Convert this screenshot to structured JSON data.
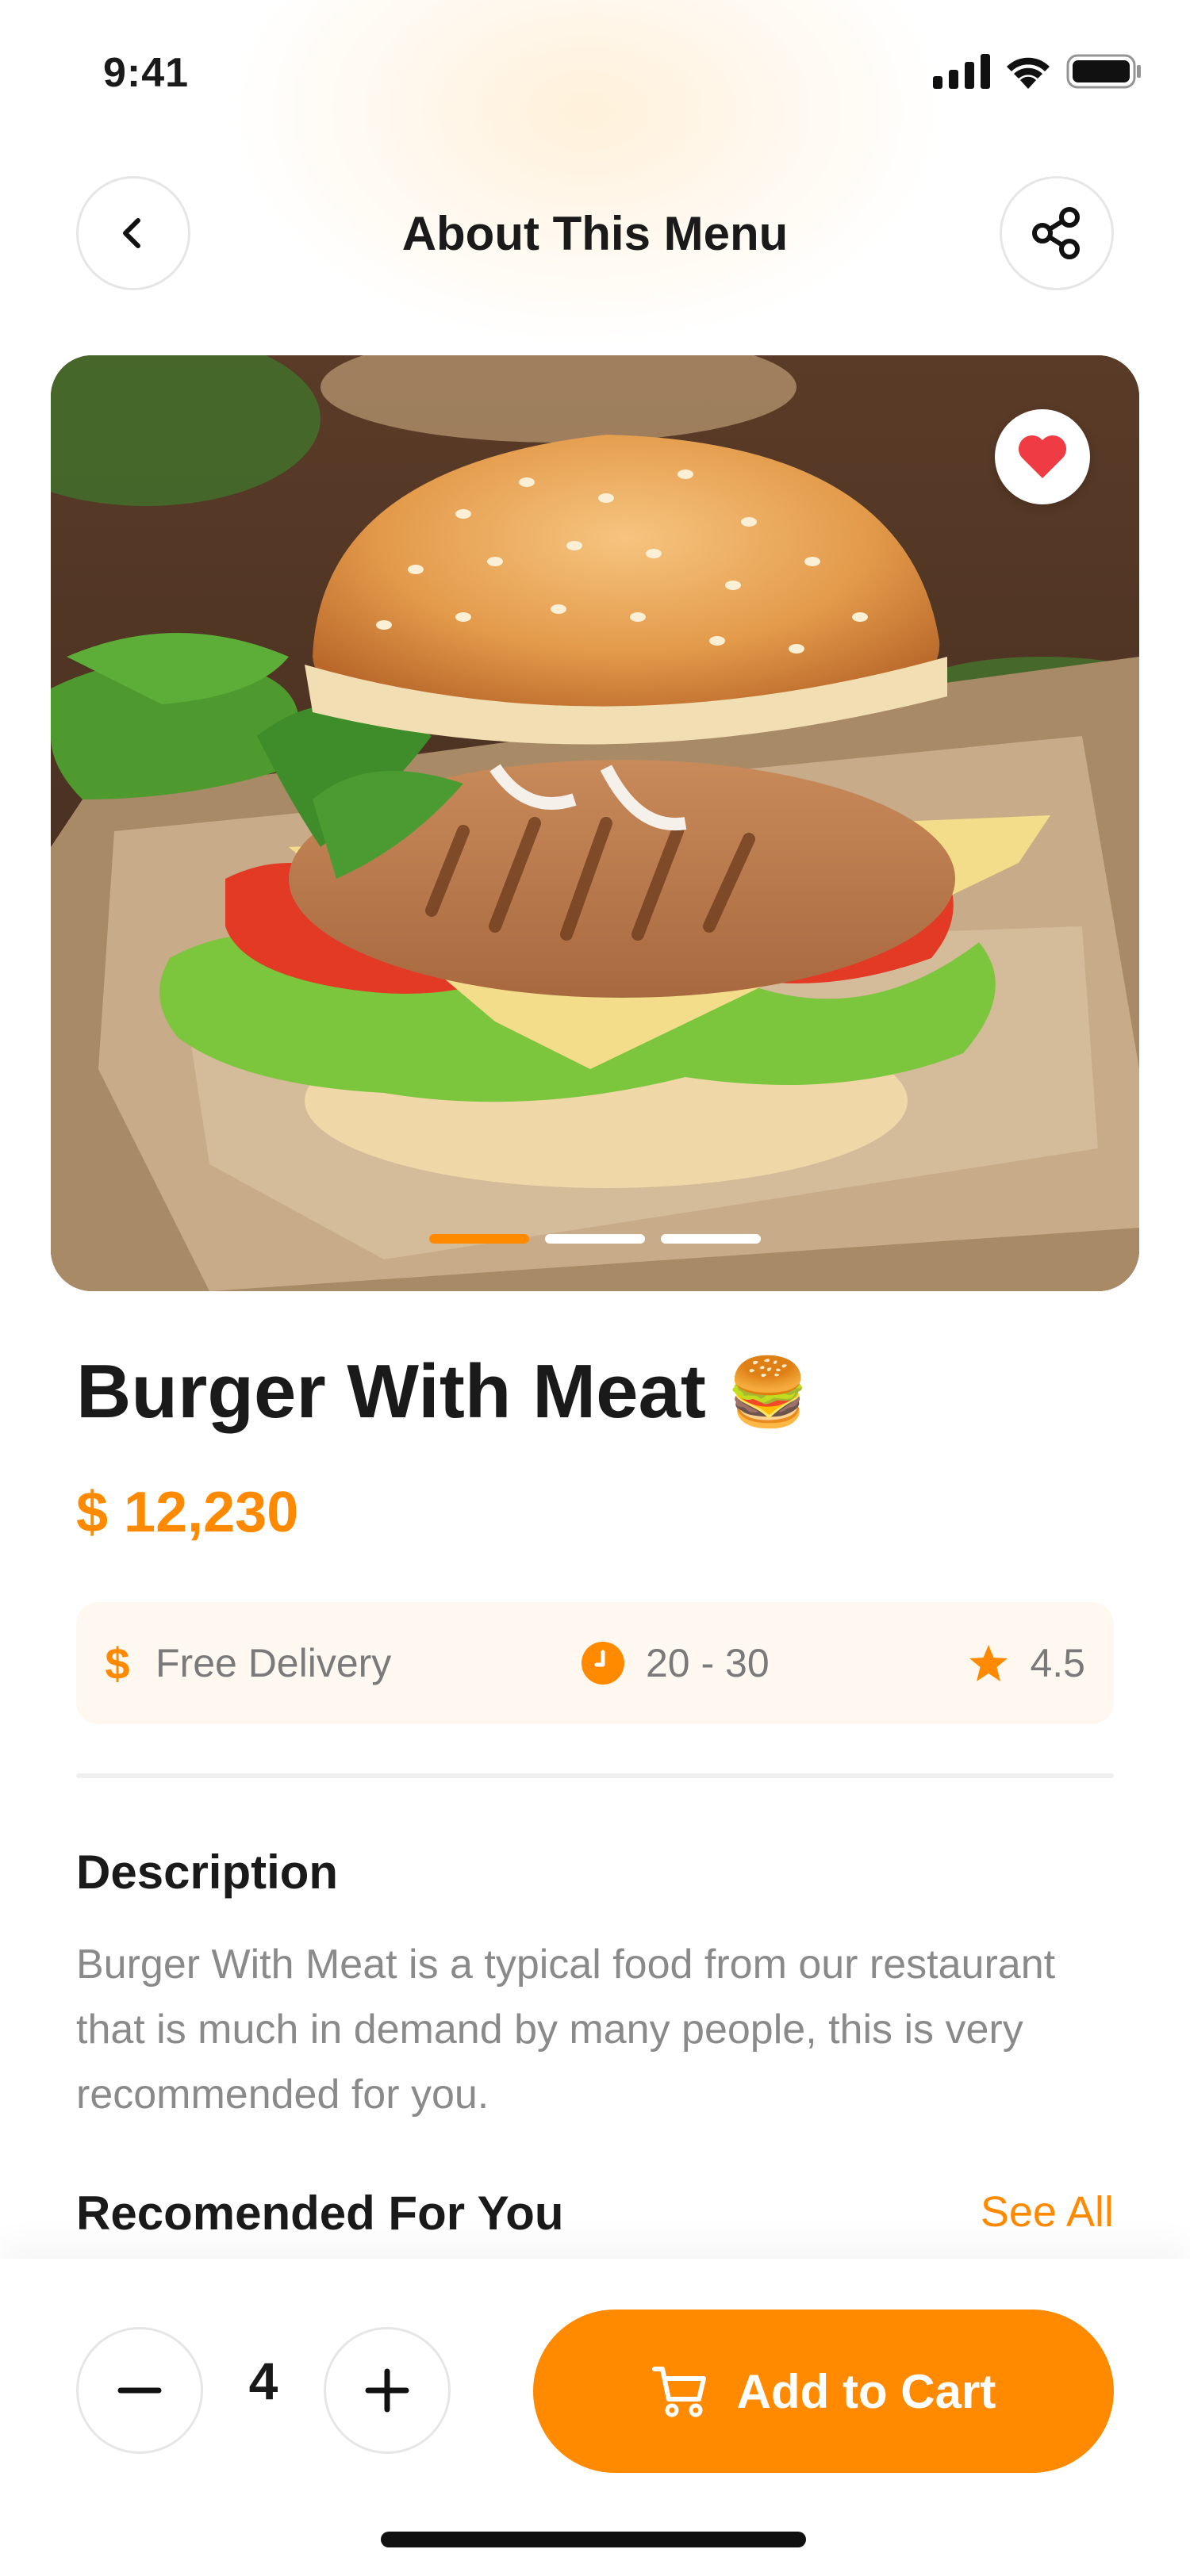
{
  "status_bar": {
    "time": "9:41"
  },
  "header": {
    "title": "About This Menu"
  },
  "hero": {
    "slide_count": 3,
    "active_slide": 1,
    "favorited": true
  },
  "product": {
    "name": "Burger With Meat",
    "emoji": "🍔",
    "price": "$ 12,230"
  },
  "info": {
    "delivery_label": "Free Delivery",
    "time_label": "20 - 30",
    "rating_label": "4.5"
  },
  "description": {
    "title": "Description",
    "text": "Burger With Meat is a typical food from our restaurant that is much in demand by many people, this is very recommended for you."
  },
  "recommended": {
    "title": "Recomended For You",
    "see_all": "See All"
  },
  "cart": {
    "quantity": "4",
    "add_label": "Add to Cart"
  },
  "colors": {
    "accent": "#ff8a00",
    "heart": "#ef3b44",
    "muted_text": "#8a8a8a",
    "info_bg": "#fff8f1"
  }
}
